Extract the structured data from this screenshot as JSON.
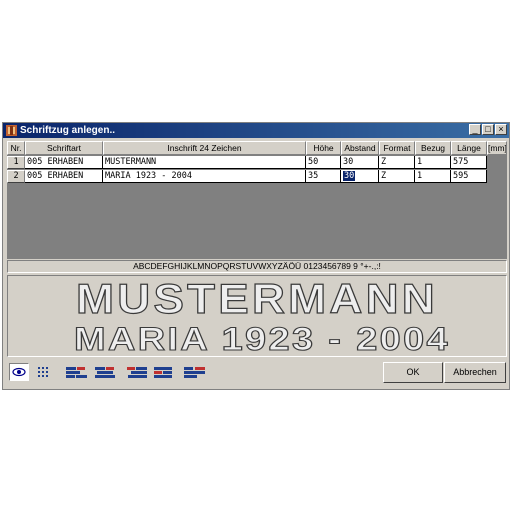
{
  "window": {
    "title": "Schriftzug anlegen..",
    "controls": {
      "minimize": "_",
      "maximize": "□",
      "close": "×"
    }
  },
  "table": {
    "headers": [
      "Nr.",
      "Schriftart",
      "Inschrift  24 Zeichen",
      "Höhe",
      "Abstand",
      "Format",
      "Bezug",
      "Länge",
      "[mm]"
    ],
    "rows": [
      {
        "nr": "1",
        "schriftart": "005 ERHABEN",
        "inschrift": "MUSTERMANN",
        "hoehe": "50",
        "abstand": "30",
        "format": "Z",
        "bezug": "1",
        "laenge": "575"
      },
      {
        "nr": "2",
        "schriftart": "005 ERHABEN",
        "inschrift": "MARIA 1923 - 2004",
        "hoehe": "35",
        "abstand": "30",
        "format": "Z",
        "bezug": "1",
        "laenge": "595"
      }
    ]
  },
  "charset": "ABCDEFGHIJKLMNOPQRSTUVWXYZÄÖÜ  0123456789 9 °+-.,:!",
  "preview": {
    "line1": "MUSTERMANN",
    "line2": "MARIA 1923 - 2004"
  },
  "toolbar": {
    "icons": [
      "eye-icon",
      "grid-dots-icon",
      "align-left-icon",
      "align-center-icon",
      "align-right-icon",
      "align-justify-icon"
    ]
  },
  "buttons": {
    "ok": "OK",
    "cancel": "Abbrechen"
  },
  "colors": {
    "titlebar": "#0a246a",
    "window": "#d4d0c8",
    "selection": "#0a246a"
  }
}
